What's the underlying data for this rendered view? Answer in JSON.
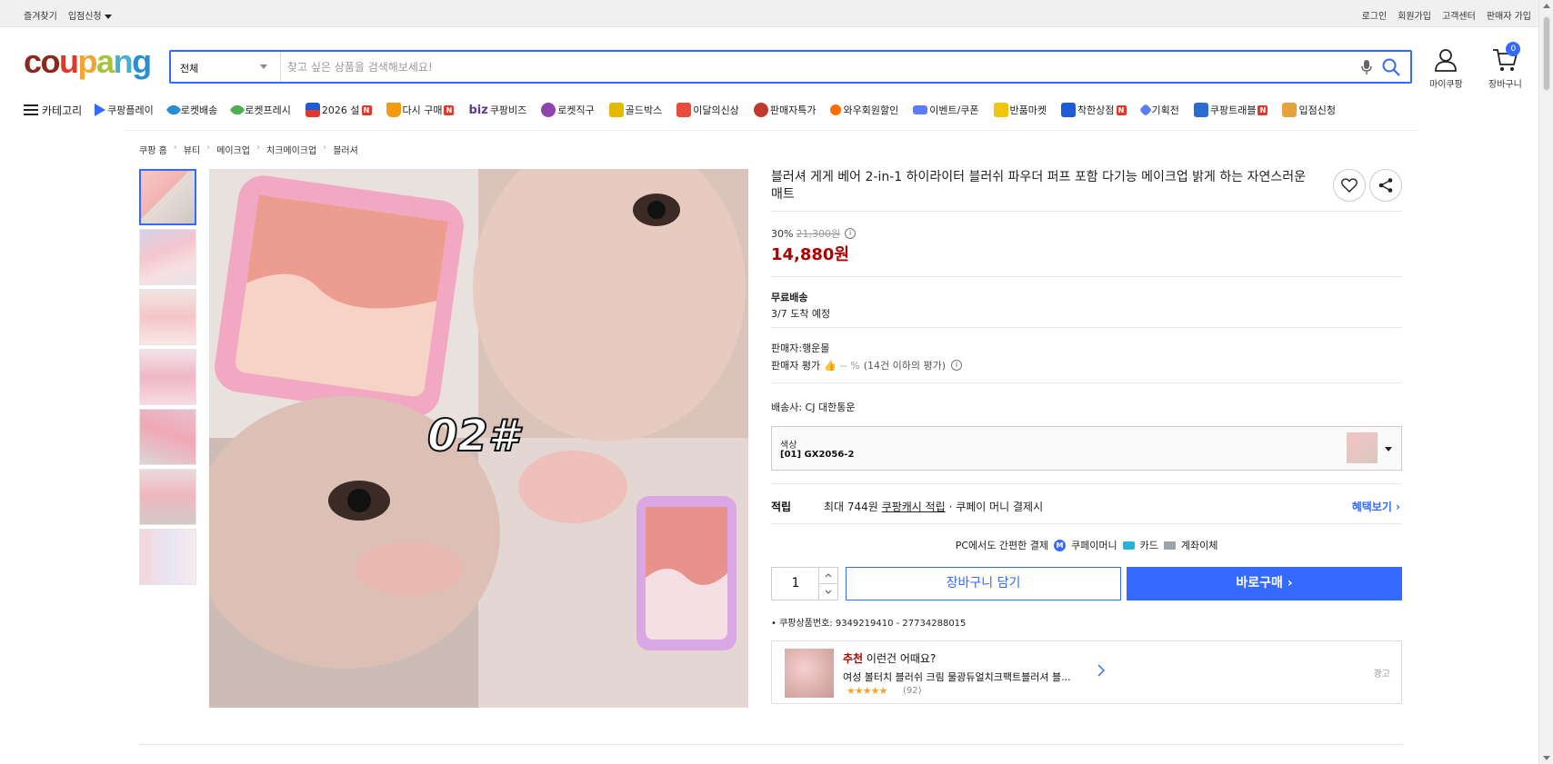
{
  "topbar": {
    "bookmark": "즐겨찾기",
    "vendor_apply": "입점신청",
    "login": "로그인",
    "signup": "회원가입",
    "support": "고객센터",
    "seller_signup": "판매자 가입"
  },
  "header": {
    "logo": [
      "c",
      "o",
      "u",
      "p",
      "a",
      "n",
      "g"
    ],
    "search_category": "전체",
    "search_placeholder": "찾고 싶은 상품을 검색해보세요!",
    "my_coupang": "마이쿠팡",
    "cart": "장바구니",
    "cart_count": "0"
  },
  "nav": {
    "category": "카테고리",
    "items": [
      {
        "label": "쿠팡플레이",
        "color": "#346aff",
        "badge": ""
      },
      {
        "label": "로켓배송",
        "color": "#2b8ed1",
        "badge": ""
      },
      {
        "label": "로켓프레시",
        "color": "#4caf50",
        "badge": ""
      },
      {
        "label": "2026 설",
        "color": "#e0392b",
        "badge": "N"
      },
      {
        "label": "다시 구매",
        "color": "#f39c12",
        "badge": "N"
      },
      {
        "label": "쿠팡비즈",
        "color": "#ffffff",
        "badge": ""
      },
      {
        "label": "로켓직구",
        "color": "#8e44ad",
        "badge": ""
      },
      {
        "label": "골드박스",
        "color": "#e6b800",
        "badge": ""
      },
      {
        "label": "이달의신상",
        "color": "#e74c3c",
        "badge": ""
      },
      {
        "label": "판매자특가",
        "color": "#c0392b",
        "badge": ""
      },
      {
        "label": "와우회원할인",
        "color": "#ff6f00",
        "badge": ""
      },
      {
        "label": "이벤트/쿠폰",
        "color": "#5c7cfa",
        "badge": ""
      },
      {
        "label": "반품마켓",
        "color": "#f1c40f",
        "badge": ""
      },
      {
        "label": "착한상점",
        "color": "#1e5bd8",
        "badge": "N"
      },
      {
        "label": "기획전",
        "color": "#5c7cfa",
        "badge": ""
      },
      {
        "label": "쿠팡트래블",
        "color": "#2b6cd1",
        "badge": "N"
      },
      {
        "label": "입점신청",
        "color": "#e6a23c",
        "badge": ""
      }
    ],
    "biz_prefix": "biz"
  },
  "breadcrumb": [
    "쿠팡 홈",
    "뷰티",
    "메이크업",
    "치크메이크업",
    "블러셔"
  ],
  "product": {
    "title": "블러셔 게게 베어 2-in-1 하이라이터 블러쉬 파우더 퍼프 포함 다기능 메이크업 밝게 하는 자연스러운 매트",
    "discount": "30%",
    "original_price": "21,300원",
    "sale_price": "14,880원",
    "image_label": "02#",
    "shipping_title": "무료배송",
    "arrival": "3/7 도착 예정",
    "seller": "판매자:행운몰",
    "seller_rating_label": "판매자 평가",
    "seller_rating_value": "-- %",
    "seller_rating_note": "(14건 이하의 평가)",
    "carrier": "배송사: CJ 대한통운",
    "option_label": "색상",
    "option_value": "[01] GX2056-2",
    "reward_label": "적립",
    "reward_text_pre": "최대 744원",
    "reward_text_link": "쿠팡캐시 적립",
    "reward_text_post": "· 쿠페이 머니 결제시",
    "reward_more": "혜택보기 ›",
    "pay_intro": "PC에서도 간편한 결제",
    "pay_methods": [
      "쿠페이머니",
      "카드",
      "계좌이체"
    ],
    "quantity": "1",
    "add_to_cart": "장바구니 담기",
    "buy_now": "바로구매 ›",
    "product_number": "쿠팡상품번호: 9349219410 - 27734288015"
  },
  "recommendation": {
    "title_red": "추천",
    "title_rest": " 이런건 어때요?",
    "name": "여성 볼터치 블러쉬 크림 물광듀얼치크팩트블러셔 블...",
    "stars": "★★★★★",
    "count": "(92)",
    "ad": "광고"
  },
  "colors": {
    "accent": "#346aff",
    "price": "#ae0000"
  }
}
